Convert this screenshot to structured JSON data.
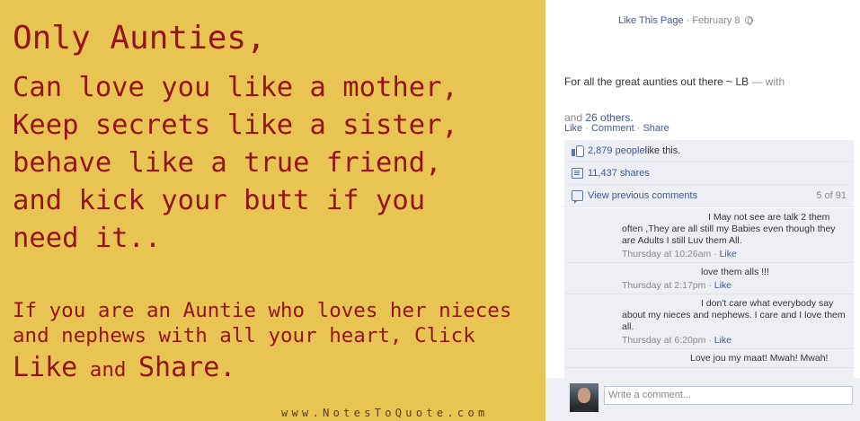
{
  "photo": {
    "line1": "Only Aunties,",
    "line2": "Can love you like a mother,",
    "line3": "Keep secrets like a sister,",
    "line4": "behave like a true friend,",
    "line5": "and kick your butt if you",
    "line6": "need it..",
    "line7": "If you are an Auntie who loves her nieces",
    "line8": "and nephews with all your heart, Click",
    "line9_like": "Like",
    "line9_and": " and ",
    "line9_share": "Share",
    "line9_end": ".",
    "watermark": "www.NotesToQuote.com"
  },
  "post": {
    "like_page": "Like This Page",
    "dot": " · ",
    "date": "February 8",
    "caption_main": "For all the great aunties out there ~ LB",
    "caption_with": " — with",
    "caption_and": "and ",
    "caption_others": "26 others.",
    "actions": {
      "like": "Like",
      "comment": "Comment",
      "share": "Share",
      "sep": " · "
    }
  },
  "ufi": {
    "likes_count": "2,879 people",
    "likes_suffix": " like this.",
    "shares": "11,437 shares",
    "view_previous": "View previous comments",
    "pager": "5 of 91"
  },
  "comments": [
    {
      "text": "I May not see are talk 2 them often ,They are all still my Babies even though they are Adults I still Luv them All.",
      "time": "Thursday at 10:26am",
      "like": "Like"
    },
    {
      "text": "love them alls !!!",
      "time": "Thursday at 2:17pm",
      "like": "Like"
    },
    {
      "text": "I don't care what everybody say about my nieces and nephews. I care and I love them all.",
      "time": "Thursday at 6:20pm",
      "like": "Like"
    },
    {
      "text": "Love jou my maat! Mwah! Mwah!",
      "time": "",
      "like": ""
    }
  ],
  "composer": {
    "placeholder": "Write a comment..."
  },
  "colors": {
    "photo_bg": "#e8c552",
    "photo_text": "#96131a",
    "link": "#3b5998",
    "ufi_bg": "#edeff4"
  }
}
